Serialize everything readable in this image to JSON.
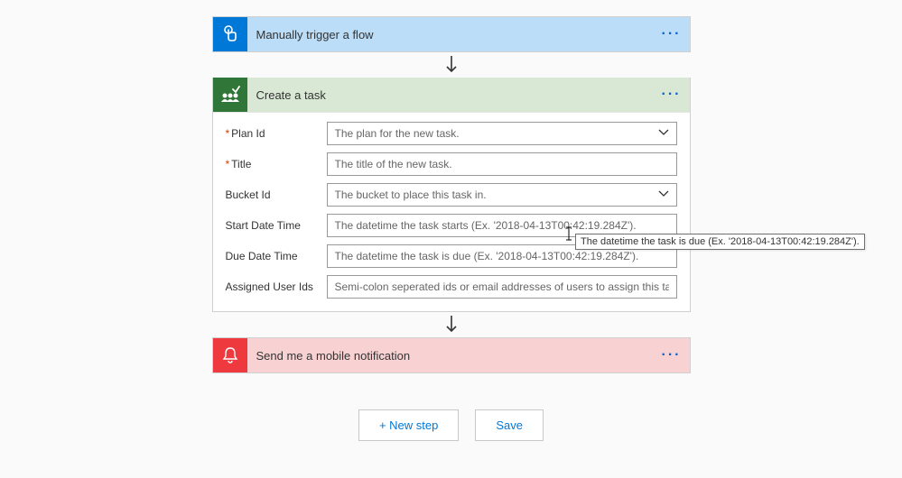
{
  "trigger": {
    "title": "Manually trigger a flow",
    "more": "···"
  },
  "action": {
    "title": "Create a task",
    "more": "···",
    "fields": {
      "plan_id": {
        "label": "Plan Id",
        "required": true,
        "placeholder": "The plan for the new task."
      },
      "title": {
        "label": "Title",
        "required": true,
        "placeholder": "The title of the new task."
      },
      "bucket_id": {
        "label": "Bucket Id",
        "required": false,
        "placeholder": "The bucket to place this task in."
      },
      "start_date": {
        "label": "Start Date Time",
        "required": false,
        "placeholder": "The datetime the task starts (Ex. '2018-04-13T00:42:19.284Z')."
      },
      "due_date": {
        "label": "Due Date Time",
        "required": false,
        "placeholder": "The datetime the task is due (Ex. '2018-04-13T00:42:19.284Z')."
      },
      "assigned": {
        "label": "Assigned User Ids",
        "required": false,
        "placeholder": "Semi-colon seperated ids or email addresses of users to assign this task to."
      }
    }
  },
  "notify": {
    "title": "Send me a mobile notification",
    "more": "···"
  },
  "buttons": {
    "new_step": "+ New step",
    "save": "Save"
  },
  "tooltip": "The datetime the task is due (Ex. '2018-04-13T00:42:19.284Z')."
}
